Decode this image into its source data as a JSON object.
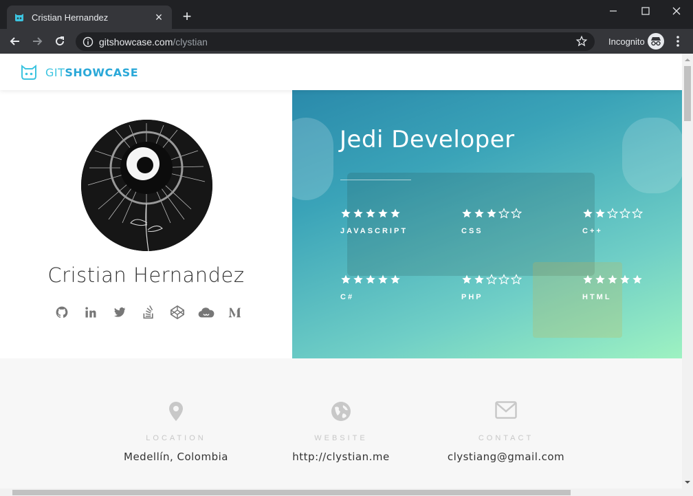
{
  "browser": {
    "tab_title": "Cristian Hernandez",
    "url_host": "gitshowcase.com",
    "url_path": "/clystian",
    "incognito_label": "Incognito",
    "new_tab_symbol": "+",
    "tab_close_symbol": "×",
    "min_symbol": "—",
    "max_symbol": "☐",
    "close_symbol": "✕"
  },
  "site": {
    "logo_git": "GIT",
    "logo_show": "SHOWCASE",
    "brand_color": "#3cc4e0"
  },
  "profile": {
    "name": "Cristian Hernandez",
    "socials": [
      "github-icon",
      "linkedin-icon",
      "twitter-icon",
      "stackoverflow-icon",
      "codepen-icon",
      "cloud-icon",
      "medium-icon"
    ]
  },
  "skills": {
    "role": "Jedi Developer",
    "items": [
      {
        "name": "JAVASCRIPT",
        "rating": 5
      },
      {
        "name": "CSS",
        "rating": 3
      },
      {
        "name": "C++",
        "rating": 2
      },
      {
        "name": "C#",
        "rating": 5
      },
      {
        "name": "PHP",
        "rating": 2
      },
      {
        "name": "HTML",
        "rating": 5
      }
    ],
    "max_rating": 5
  },
  "contact": {
    "location_label": "LOCATION",
    "location_value": "Medellín, Colombia",
    "website_label": "WEBSITE",
    "website_value": "http://clystian.me",
    "contact_label": "CONTACT",
    "contact_value": "clystiang@gmail.com"
  }
}
